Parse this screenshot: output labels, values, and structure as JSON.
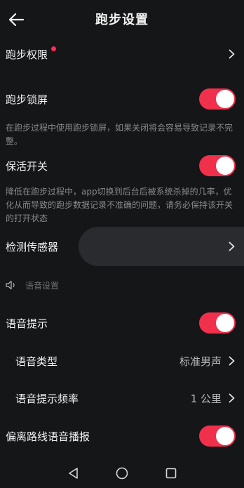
{
  "header": {
    "title": "跑步设置",
    "back_icon": "arrow-left-icon"
  },
  "rows": {
    "permissions": {
      "label": "跑步权限",
      "has_badge": true
    },
    "lock_screen": {
      "label": "跑步锁屏",
      "enabled": true
    },
    "lock_screen_desc": "在跑步过程中使用跑步锁屏，如果关闭将会容易导致记录不完整。",
    "keep_alive": {
      "label": "保活开关",
      "enabled": true
    },
    "keep_alive_desc": "降低在跑步过程中，app切换到后台后被系统杀掉的几率，优化从而导致的跑步数据记录不准确的问题，请务必保持该开关的打开状态",
    "sensor_check": {
      "label": "检测传感器"
    }
  },
  "voice_section": {
    "title": "语音设置",
    "icon": "speaker-icon",
    "voice_prompt": {
      "label": "语音提示",
      "enabled": true
    },
    "voice_type": {
      "label": "语音类型",
      "value": "标准男声"
    },
    "prompt_frequency": {
      "label": "语音提示频率",
      "value": "1 公里"
    },
    "off_route": {
      "label": "偏离路线语音播报",
      "enabled": true
    }
  },
  "navbar": {
    "back": "triangle-back-icon",
    "home": "circle-home-icon",
    "recents": "square-recents-icon"
  },
  "colors": {
    "background": "#151618",
    "toggle_on": "#f1304b",
    "badge": "#ff2b54",
    "desc_text": "#8a8b8e"
  }
}
